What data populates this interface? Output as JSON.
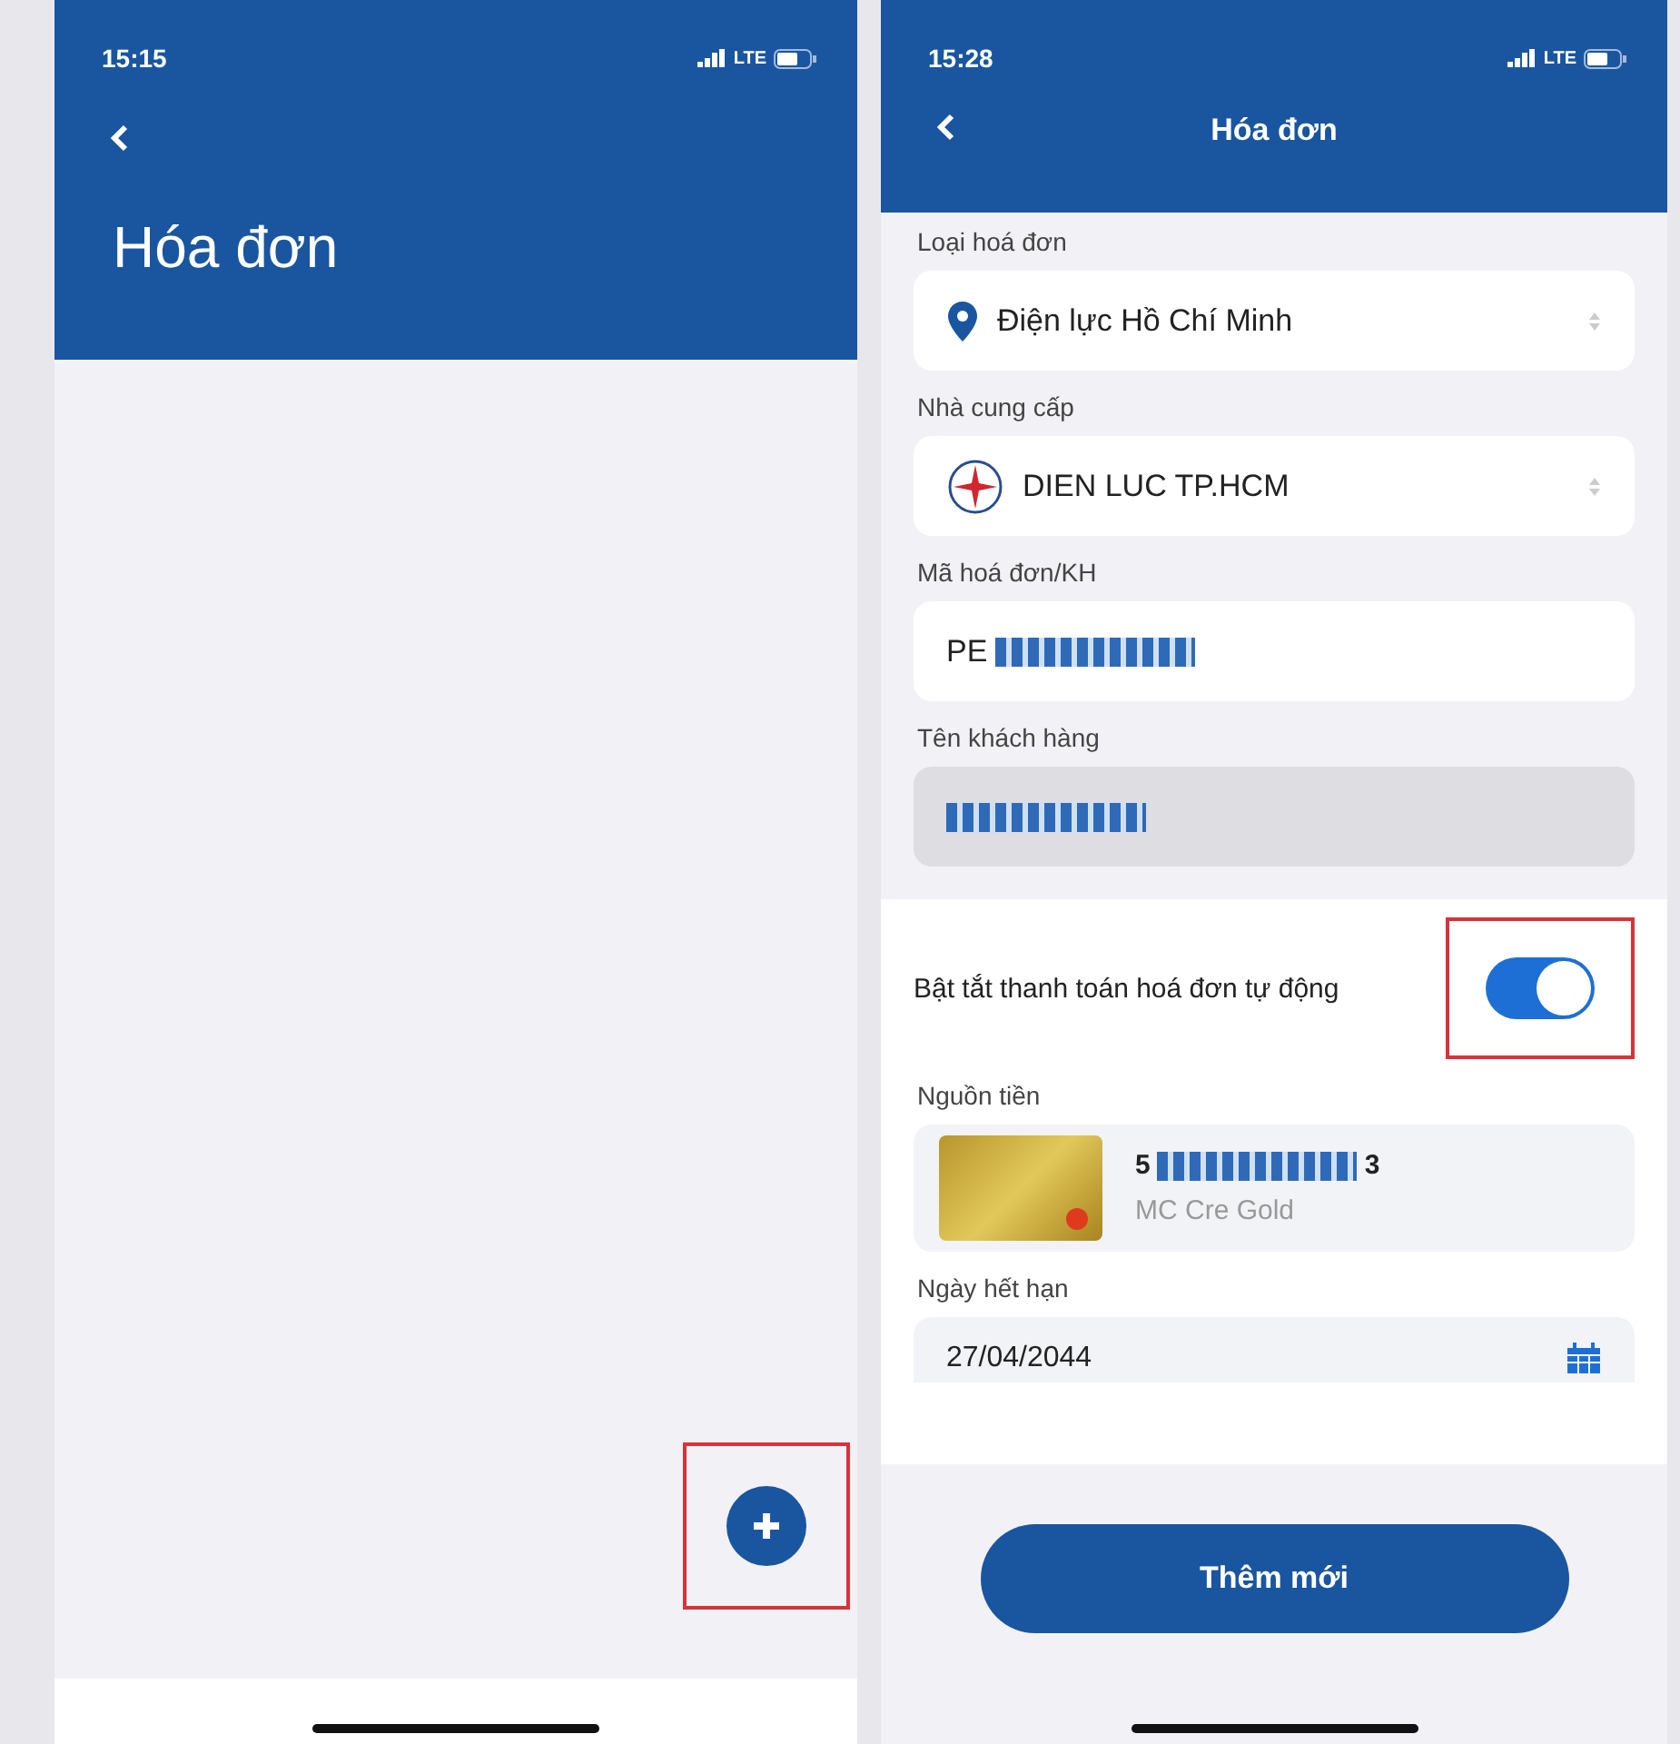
{
  "left_screen": {
    "status_bar": {
      "time": "15:15",
      "network": "LTE"
    },
    "title": "Hóa đơn",
    "add_button": {
      "highlighted": true
    }
  },
  "right_screen": {
    "status_bar": {
      "time": "15:28",
      "network": "LTE"
    },
    "title": "Hóa đơn",
    "fields": [
      {
        "kind": "select",
        "label": "Loại hoá đơn",
        "value": "Điện lực Hồ Chí Minh"
      },
      {
        "kind": "select",
        "label": "Nhà cung cấp",
        "value": "DIEN LUC TP.HCM"
      },
      {
        "kind": "input",
        "label": "Mã hoá đơn/KH",
        "value": "PE",
        "redacted": true
      },
      {
        "kind": "readonly",
        "label": "Tên khách hàng",
        "redacted": true
      },
      {
        "kind": "toggle",
        "label": "Bật tắt thanh toán hoá đơn tự động",
        "on": true,
        "highlighted": true
      },
      {
        "kind": "card",
        "label": "Nguồn tiền",
        "number_start": "5",
        "number_end": "3",
        "name": "MC Cre Gold"
      },
      {
        "kind": "date",
        "label": "Ngày hết hạn",
        "value": "27/04/2044"
      }
    ],
    "submit_button": "Thêm mới"
  }
}
